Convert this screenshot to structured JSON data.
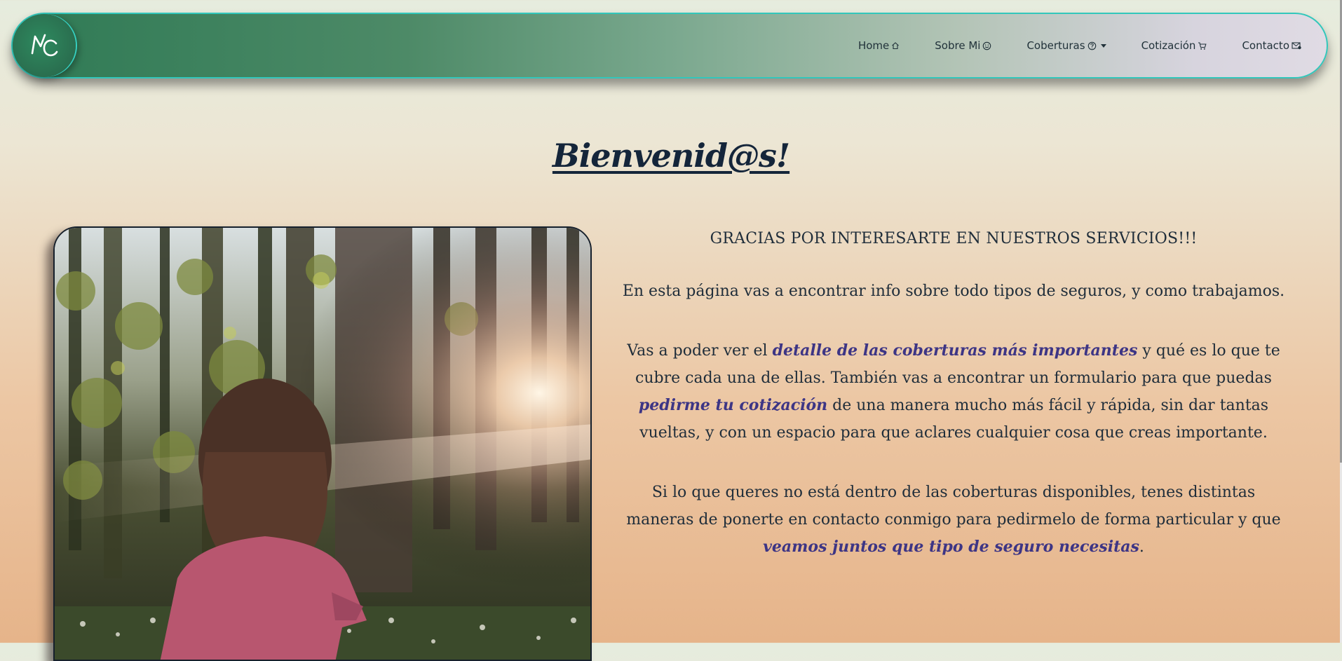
{
  "nav": {
    "logo_text": "MC",
    "items": [
      {
        "label": "Home",
        "icon": "house-icon"
      },
      {
        "label": "Sobre Mi",
        "icon": "smiley-icon"
      },
      {
        "label": "Coberturas",
        "icon": "question-circle-icon",
        "dropdown": true
      },
      {
        "label": "Cotización",
        "icon": "cart-icon"
      },
      {
        "label": "Contacto",
        "icon": "envelope-icon"
      }
    ]
  },
  "main": {
    "title": "Bienvenid@s!",
    "subtitle": "GRACIAS POR INTERESARTE EN NUESTROS SERVICIOS!!!",
    "p1": "En esta página vas a encontrar info sobre todo tipos de seguros, y como trabajamos.",
    "p2": {
      "a": "Vas a poder ver el ",
      "em1": "detalle de las coberturas más importantes",
      "b": " y qué es lo que te cubre cada una de ellas. También vas a encontrar un formulario para que puedas ",
      "em2": "pedirme tu cotización",
      "c": " de una manera mucho más fácil y rápida, sin dar tantas vueltas, y con un espacio para que aclares cualquier cosa que creas importante."
    },
    "p3": {
      "a": "Si lo que queres no está dentro de las coberturas disponibles, tenes distintas maneras de ponerte en contacto conmigo para pedirmelo de forma particular y que ",
      "em1": "veamos juntos que tipo de seguro necesitas",
      "b": "."
    }
  },
  "colors": {
    "accent_teal": "#32c7bb",
    "nav_green": "#2f7a55",
    "emphasis_purple": "#3d3585",
    "text_dark": "#1f2d3a"
  }
}
